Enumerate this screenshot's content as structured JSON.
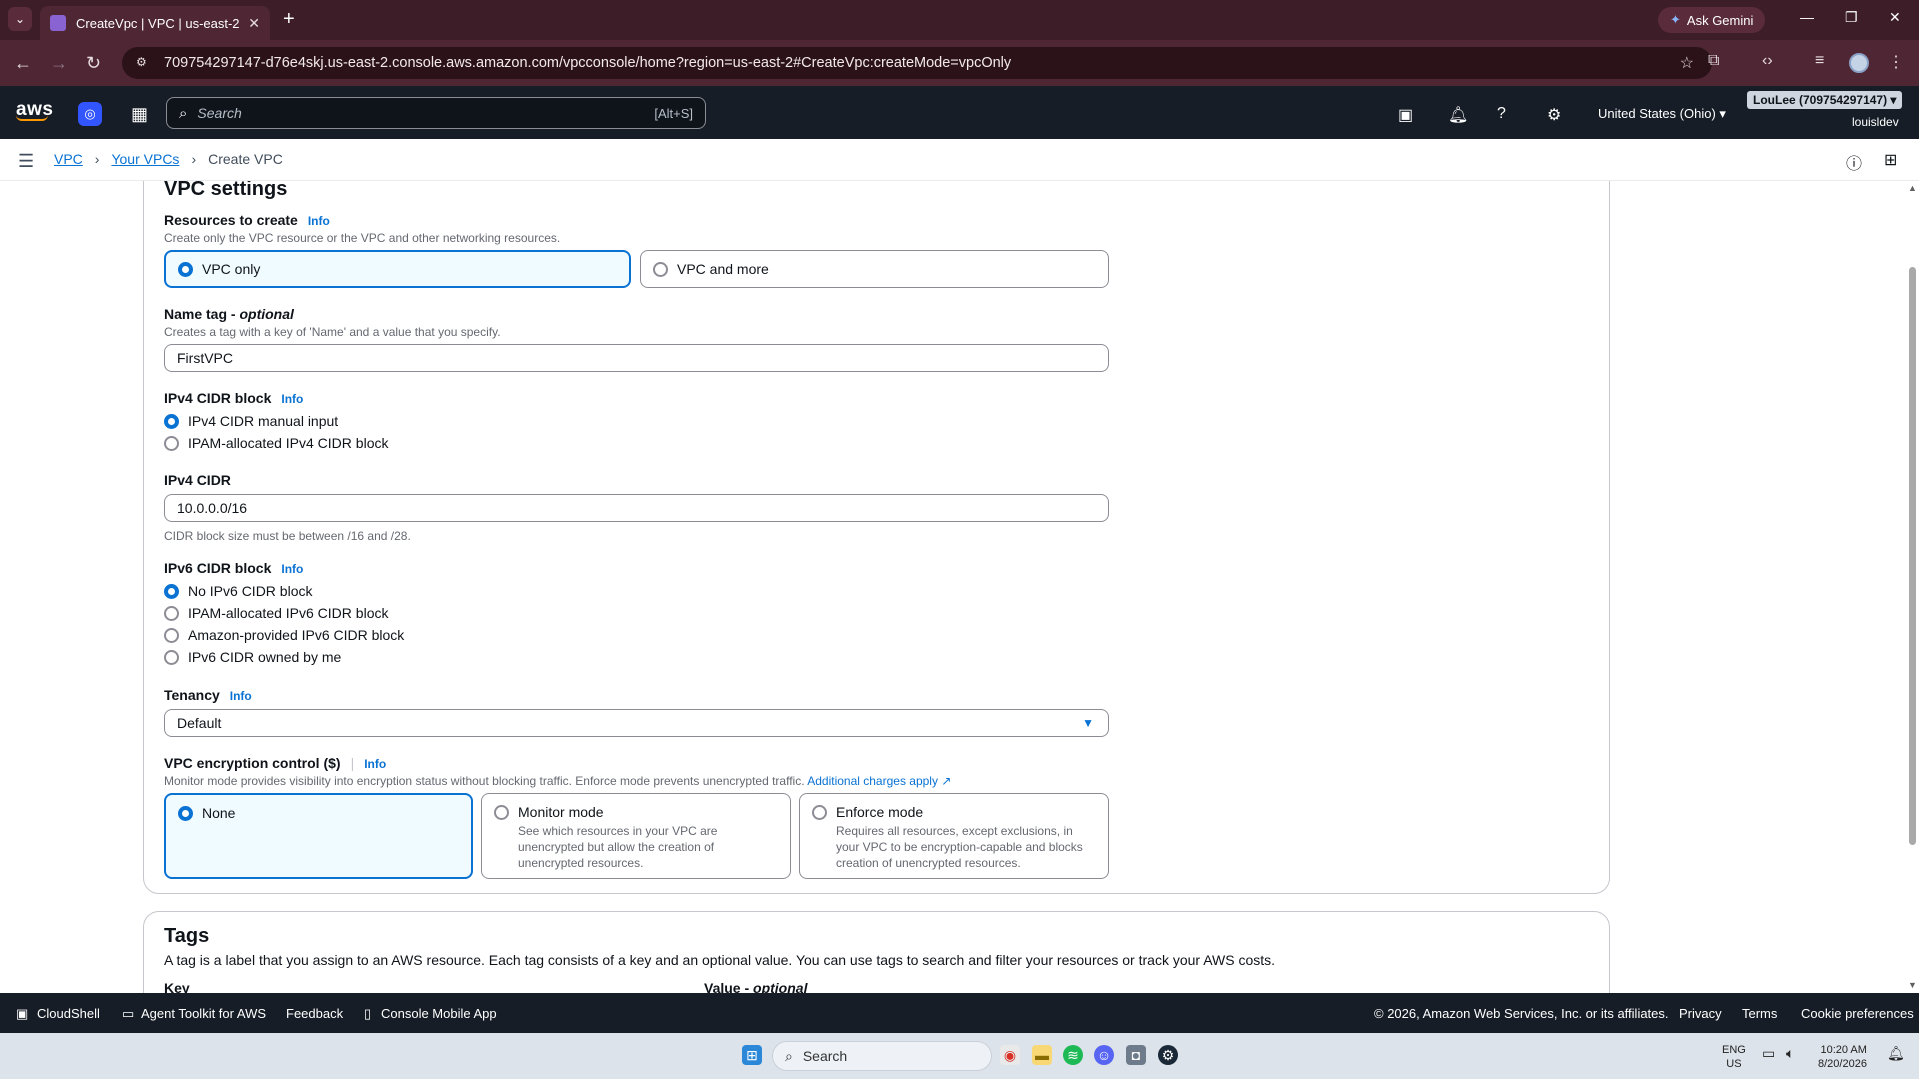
{
  "browser": {
    "tab_title": "CreateVpc | VPC | us-east-2",
    "url": "709754297147-d76e4skj.us-east-2.console.aws.amazon.com/vpcconsole/home?region=us-east-2#CreateVpc:createMode=vpcOnly",
    "gemini_label": "Ask Gemini"
  },
  "aws_header": {
    "logo": "aws",
    "search_placeholder": "Search",
    "search_shortcut": "[Alt+S]",
    "region": "United States (Ohio) ▾",
    "account": "LouLee (709754297147) ▾",
    "user": "louisldev"
  },
  "breadcrumb": {
    "items": [
      "VPC",
      "Your VPCs"
    ],
    "current": "Create VPC"
  },
  "vpc_settings": {
    "title": "VPC settings",
    "resources": {
      "label": "Resources to create",
      "info": "Info",
      "desc": "Create only the VPC resource or the VPC and other networking resources.",
      "options": [
        "VPC only",
        "VPC and more"
      ],
      "selected": "VPC only"
    },
    "name_tag": {
      "label": "Name tag - ",
      "optional": "optional",
      "desc": "Creates a tag with a key of 'Name' and a value that you specify.",
      "value": "FirstVPC"
    },
    "ipv4_block": {
      "label": "IPv4 CIDR block",
      "info": "Info",
      "options": [
        "IPv4 CIDR manual input",
        "IPAM-allocated IPv4 CIDR block"
      ],
      "selected": "IPv4 CIDR manual input"
    },
    "ipv4_cidr": {
      "label": "IPv4 CIDR",
      "value": "10.0.0.0/16",
      "hint": "CIDR block size must be between /16 and /28."
    },
    "ipv6_block": {
      "label": "IPv6 CIDR block",
      "info": "Info",
      "options": [
        "No IPv6 CIDR block",
        "IPAM-allocated IPv6 CIDR block",
        "Amazon-provided IPv6 CIDR block",
        "IPv6 CIDR owned by me"
      ],
      "selected": "No IPv6 CIDR block"
    },
    "tenancy": {
      "label": "Tenancy",
      "info": "Info",
      "value": "Default"
    },
    "encryption": {
      "label": "VPC encryption control ($)",
      "info": "Info",
      "desc": "Monitor mode provides visibility into encryption status without blocking traffic. Enforce mode prevents unencrypted traffic.",
      "link": "Additional charges apply",
      "options": [
        {
          "title": "None",
          "desc": ""
        },
        {
          "title": "Monitor mode",
          "desc": "See which resources in your VPC are unencrypted but allow the creation of unencrypted resources."
        },
        {
          "title": "Enforce mode",
          "desc": "Requires all resources, except exclusions, in your VPC to be encryption-capable and blocks creation of unencrypted resources."
        }
      ],
      "selected": "None"
    }
  },
  "tags": {
    "title": "Tags",
    "desc": "A tag is a label that you assign to an AWS resource. Each tag consists of a key and an optional value. You can use tags to search and filter your resources or track your AWS costs.",
    "key_label": "Key",
    "value_label": "Value - ",
    "value_optional": "optional"
  },
  "footer": {
    "cloudshell": "CloudShell",
    "agent_toolkit": "Agent Toolkit for AWS",
    "feedback": "Feedback",
    "mobile_app": "Console Mobile App",
    "copyright": "© 2026, Amazon Web Services, Inc. or its affiliates.",
    "privacy": "Privacy",
    "terms": "Terms",
    "cookies": "Cookie preferences"
  },
  "taskbar": {
    "search_placeholder": "Search",
    "lang_top": "ENG",
    "lang_bottom": "US",
    "time": "10:20 AM",
    "date": "8/20/2026"
  }
}
